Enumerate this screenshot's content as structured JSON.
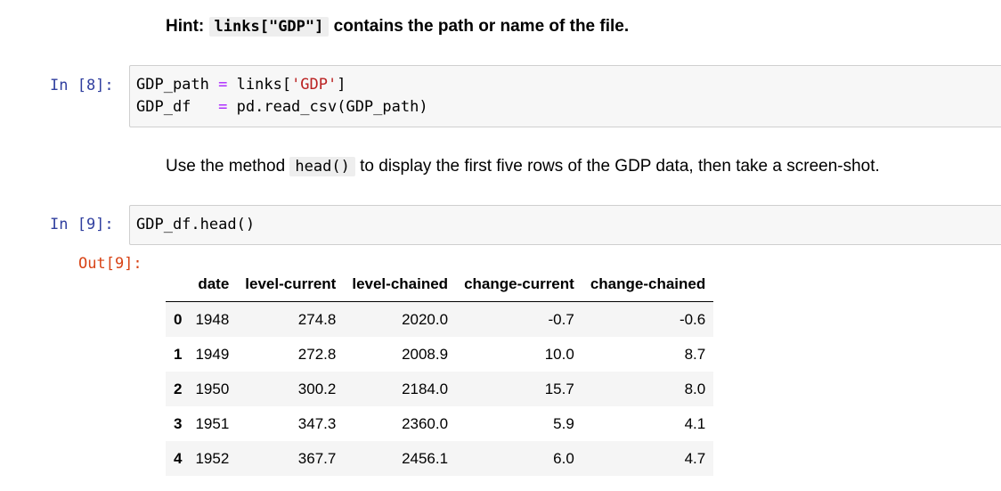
{
  "hint": {
    "label": "Hint:",
    "code": "links[\"GDP\"]",
    "text": "contains the path or name of the file."
  },
  "cell8": {
    "prompt": "In [8]:",
    "lines": [
      {
        "var": "GDP_path",
        "op": "=",
        "pre": "links[",
        "str": "'GDP'",
        "post": "]"
      },
      {
        "var": "GDP_df",
        "op": "=",
        "rest": "pd.read_csv(GDP_path)"
      }
    ]
  },
  "instruction": {
    "before": "Use the method",
    "code": "head()",
    "after": "to display the first five rows of the GDP data, then take a screen-shot."
  },
  "cell9": {
    "prompt": "In [9]:",
    "code": "GDP_df.head()",
    "out_prompt": "Out[9]:"
  },
  "table": {
    "columns": [
      "",
      "date",
      "level-current",
      "level-chained",
      "change-current",
      "change-chained"
    ],
    "rows": [
      {
        "index": "0",
        "date": "1948",
        "level_current": "274.8",
        "level_chained": "2020.0",
        "change_current": "-0.7",
        "change_chained": "-0.6"
      },
      {
        "index": "1",
        "date": "1949",
        "level_current": "272.8",
        "level_chained": "2008.9",
        "change_current": "10.0",
        "change_chained": "8.7"
      },
      {
        "index": "2",
        "date": "1950",
        "level_current": "300.2",
        "level_chained": "2184.0",
        "change_current": "15.7",
        "change_chained": "8.0"
      },
      {
        "index": "3",
        "date": "1951",
        "level_current": "347.3",
        "level_chained": "2360.0",
        "change_current": "5.9",
        "change_chained": "4.1"
      },
      {
        "index": "4",
        "date": "1952",
        "level_current": "367.7",
        "level_chained": "2456.1",
        "change_current": "6.0",
        "change_chained": "4.7"
      }
    ]
  }
}
